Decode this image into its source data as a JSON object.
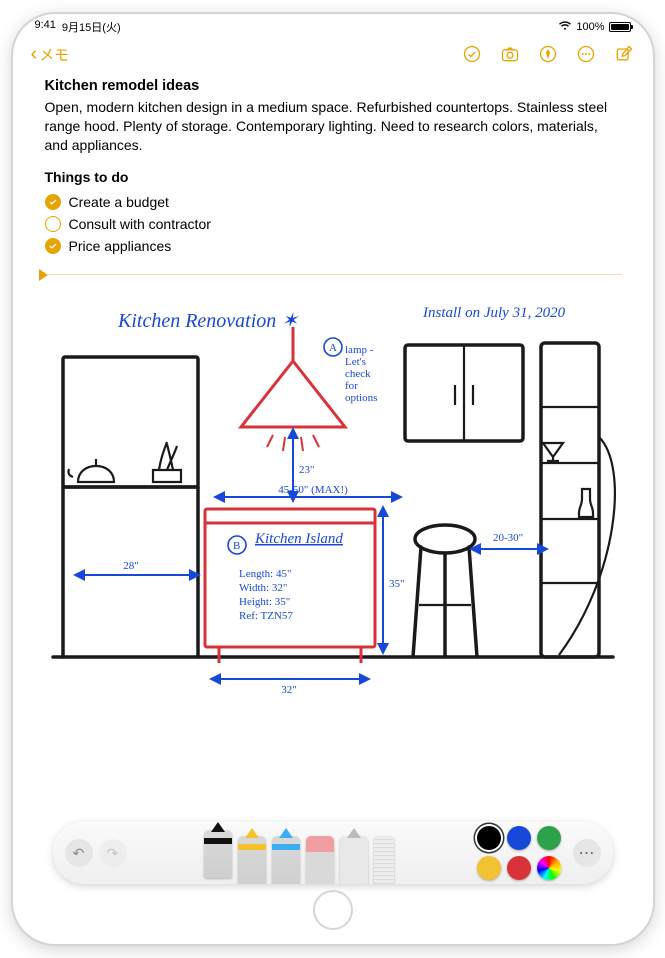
{
  "status": {
    "time": "9:41",
    "date": "9月15日(火)",
    "battery_pct": "100%"
  },
  "nav": {
    "back_label": "メモ"
  },
  "note": {
    "date_line": "",
    "title": "Kitchen remodel ideas",
    "description": "Open, modern kitchen design in a medium space. Refurbished countertops. Stainless steel range hood. Plenty of storage. Contemporary lighting. Need to research colors, materials, and appliances.",
    "things_label": "Things to do",
    "todos": [
      {
        "text": "Create a budget",
        "checked": true
      },
      {
        "text": "Consult with contractor",
        "checked": false
      },
      {
        "text": "Price appliances",
        "checked": true
      }
    ]
  },
  "drawing": {
    "header_left": "Kitchen Renovation ✶",
    "header_right": "Install on July 31, 2020",
    "lamp_label_letter": "A",
    "lamp_note": "lamp - Let's check for options",
    "lamp_dim": "23\"",
    "width_note": "45-50\" (MAX!)",
    "island_title": "Kitchen Island",
    "island_letter": "B",
    "island_specs": "Length: 45\"\nWidth: 32\"\nHeight: 35\"\nRef: TZN57",
    "dim_left": "28\"",
    "dim_bottom": "32\"",
    "dim_height": "35\"",
    "dim_right": "20-30\""
  },
  "toolbar": {
    "colors": [
      "#000000",
      "#1848d9",
      "#2da24a",
      "#f2c233",
      "#d9333a"
    ]
  }
}
